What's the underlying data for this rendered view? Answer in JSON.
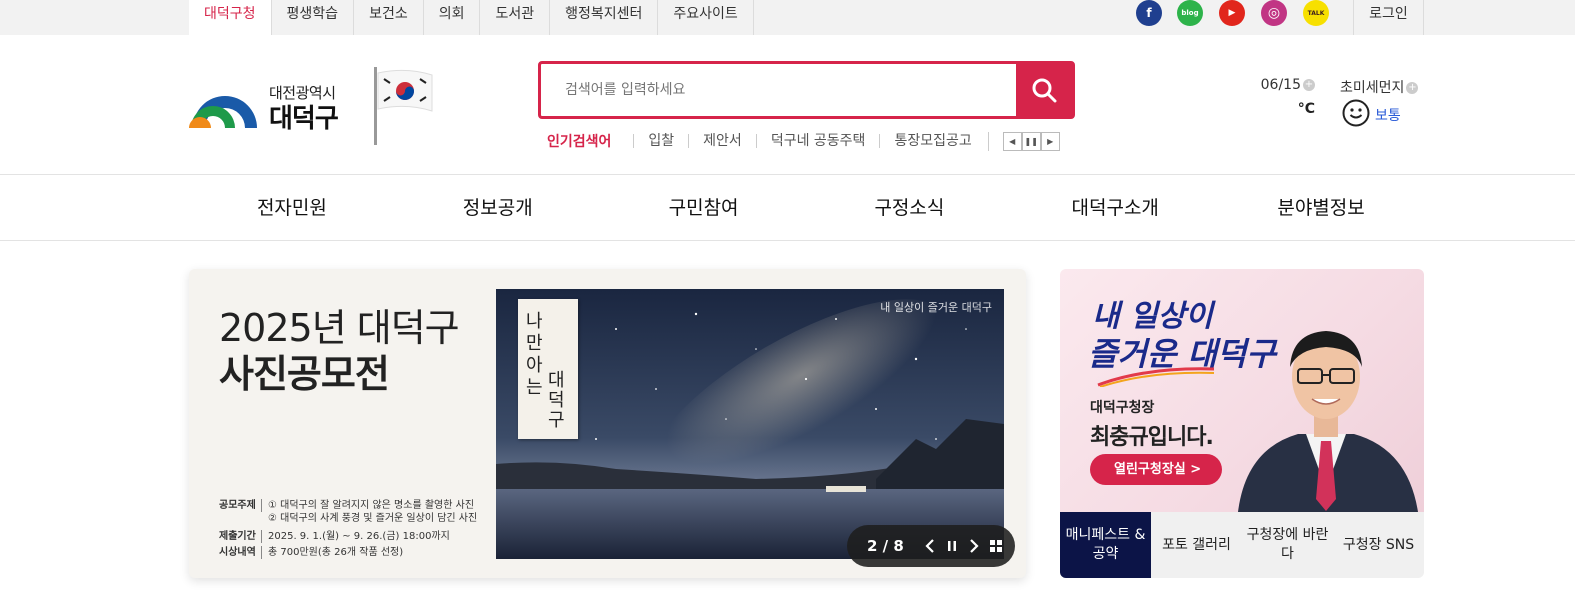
{
  "topbar": {
    "tabs": [
      {
        "label": "대덕구청"
      },
      {
        "label": "평생학습"
      },
      {
        "label": "보건소"
      },
      {
        "label": "의회"
      },
      {
        "label": "도서관"
      },
      {
        "label": "행정복지센터"
      },
      {
        "label": "주요사이트"
      }
    ],
    "social": [
      {
        "icon": "facebook-icon",
        "glyph": "f",
        "color": "#1f3f8f"
      },
      {
        "icon": "blog-icon",
        "glyph": "blog",
        "color": "#2db34a"
      },
      {
        "icon": "youtube-icon",
        "glyph": "▶",
        "color": "#e1261c"
      },
      {
        "icon": "instagram-icon",
        "glyph": "◎",
        "color": "#c13584"
      },
      {
        "icon": "kakaotalk-icon",
        "glyph": "TALK",
        "color": "#f7e000"
      }
    ],
    "login": "로그인"
  },
  "logo": {
    "line1": "대전광역시",
    "line2": "대덕구"
  },
  "search": {
    "placeholder": "검색어를 입력하세요",
    "button_icon": "search-icon"
  },
  "popular": {
    "title": "인기검색어",
    "keywords": [
      "입찰",
      "제안서",
      "덕구네 공동주택",
      "통장모집공고"
    ],
    "controls": [
      "◀",
      "❚❚",
      "▶"
    ]
  },
  "weather": {
    "date": "06/15",
    "temp": "°C"
  },
  "dust": {
    "label": "초미세먼지",
    "status": "보통"
  },
  "gnb": {
    "items": [
      "전자민원",
      "정보공개",
      "구민참여",
      "구정소식",
      "대덕구소개",
      "분야별정보"
    ]
  },
  "banner": {
    "title_line1": "2025년 대덕구",
    "title_line2": "사진공모전",
    "info": [
      {
        "key": "공모주제",
        "value": "① 대덕구의 잘 알려지지 않은 명소를 촬영한 사진"
      },
      {
        "key": "",
        "value": "② 대덕구의 사계 풍경 및 즐거운 일상이 담긴 사진"
      },
      {
        "key": "제출기간",
        "value": "2025. 9. 1.(월) ~ 9. 26.(금) 18:00까지"
      },
      {
        "key": "시상내역",
        "value": "총 700만원(총 26개 작품 선정)"
      }
    ],
    "paper_text1": "나만아는",
    "paper_text2": "대덕구",
    "photo_brand": "내 일상이 즐거운 대덕구",
    "pager": "2 / 8"
  },
  "mayor": {
    "slogan_line1": "내 일상이",
    "slogan_line2": "즐거운 대덕구",
    "role": "대덕구청장",
    "name": "최충규입니다.",
    "open_button": "열린구청장실  >",
    "tabs": [
      {
        "label": "매니페스트 & 공약"
      },
      {
        "label": "포토 갤러리"
      },
      {
        "label": "구청장에 바란다"
      },
      {
        "label": "구청장 SNS"
      }
    ]
  }
}
